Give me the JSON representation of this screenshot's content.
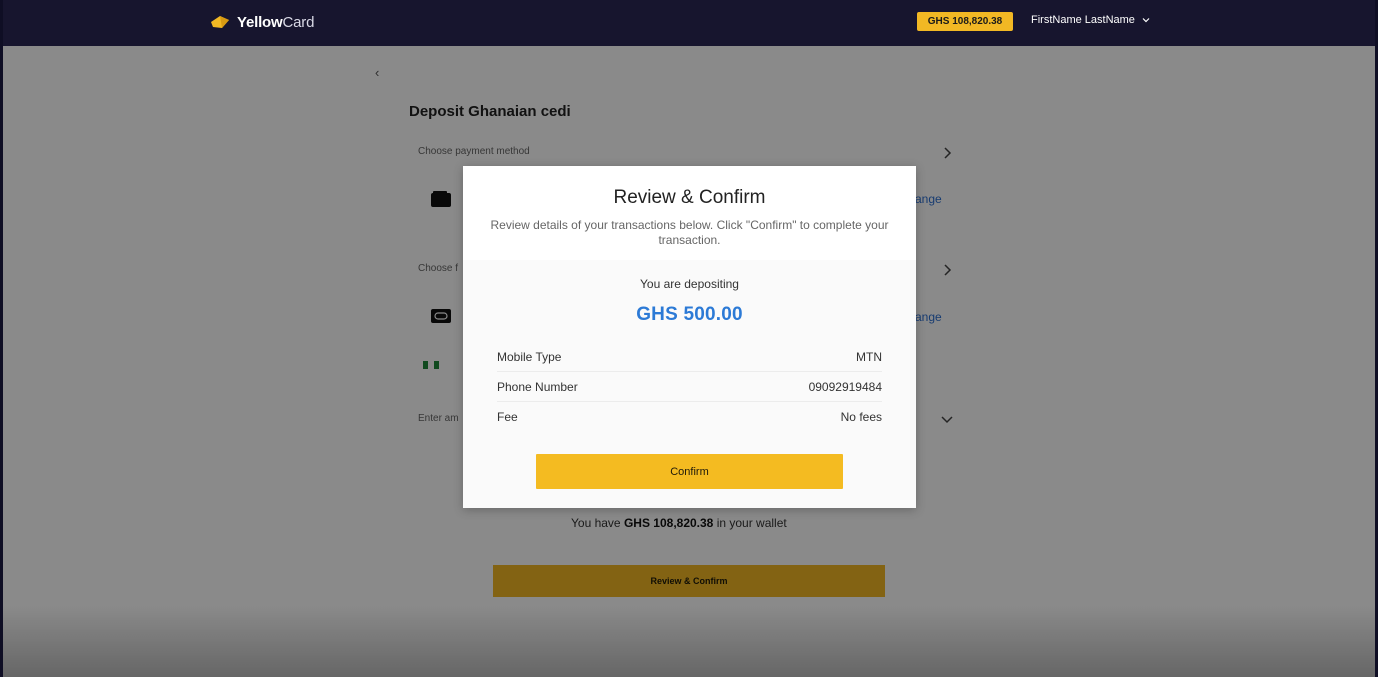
{
  "header": {
    "logo_main": "Yellow",
    "logo_suffix": "Card",
    "balance": "GHS 108,820.38",
    "user_name": "FirstName LastName"
  },
  "page": {
    "back_icon": "‹",
    "title": "Deposit Ghanaian cedi",
    "payment_method_label": "Choose payment method",
    "second_section_label": "Choose f",
    "change_label_1": "ange",
    "change_label_2": "ange",
    "amount_label": "Enter am",
    "wallet_prefix": "You have",
    "wallet_amount": "GHS 108,820.38",
    "wallet_suffix": "in your wallet",
    "review_button": "Review & Confirm"
  },
  "modal": {
    "title": "Review & Confirm",
    "subtitle": "Review details of your transactions below. Click \"Confirm\" to complete your transaction.",
    "depositing_label": "You are depositing",
    "amount": "GHS 500.00",
    "details": [
      {
        "label": "Mobile Type",
        "value": "MTN"
      },
      {
        "label": "Phone Number",
        "value": "09092919484"
      },
      {
        "label": "Fee",
        "value": "No fees"
      }
    ],
    "confirm_button": "Confirm"
  },
  "colors": {
    "nav_bg": "#17152e",
    "accent_yellow": "#f2b824",
    "link_blue": "#2c6fd1",
    "amount_blue": "#2c7ad6"
  },
  "icons": {
    "logo": "yellowcard-logo-icon",
    "back": "chevron-left-icon",
    "user_menu": "chevron-down-icon",
    "wallet": "wallet-icon",
    "mobile_money": "mobile-money-icon",
    "expand": "chevron-right-icon"
  }
}
